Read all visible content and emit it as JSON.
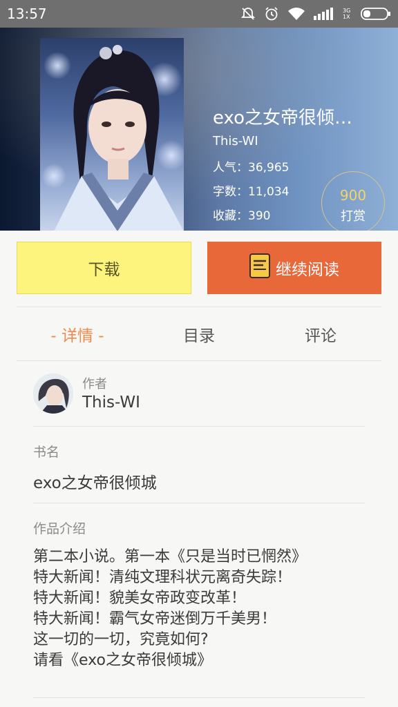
{
  "status_bar": {
    "time": "13:57",
    "network": "3G 1X"
  },
  "book": {
    "title": "exo之女帝很倾…",
    "author": "This-WI",
    "popularity": "人气：36,965",
    "word_count": "字数：11,034",
    "favorites": "收藏：390"
  },
  "tip": {
    "amount": "900",
    "label": "打赏"
  },
  "buttons": {
    "download": "下载",
    "continue_reading": "继续阅读"
  },
  "tabs": [
    {
      "label": "- 详情 -",
      "active": true
    },
    {
      "label": "目录",
      "active": false
    },
    {
      "label": "评论",
      "active": false
    }
  ],
  "details": {
    "author_label": "作者",
    "author_name": "This-WI",
    "book_name_label": "书名",
    "book_name": "exo之女帝很倾城",
    "intro_label": "作品介绍",
    "intro_lines": [
      "第二本小说。第一本《只是当时已惘然》",
      "特大新闻！清纯文理科状元离奇失踪！",
      "特大新闻！貌美女帝政变改革！",
      "特大新闻！霸气女帝迷倒万千美男！",
      "这一切的一切，究竟如何?",
      "请看《exo之女帝很倾城》"
    ]
  },
  "colors": {
    "accent": "#e8683a",
    "download_bg": "#fdf47e",
    "active_tab": "#f08a4b",
    "tip_number": "#f4d36a"
  },
  "icons": [
    "alarm-off-icon",
    "alarm-icon",
    "wifi-icon",
    "signal-icon",
    "battery-icon",
    "book-icon"
  ]
}
